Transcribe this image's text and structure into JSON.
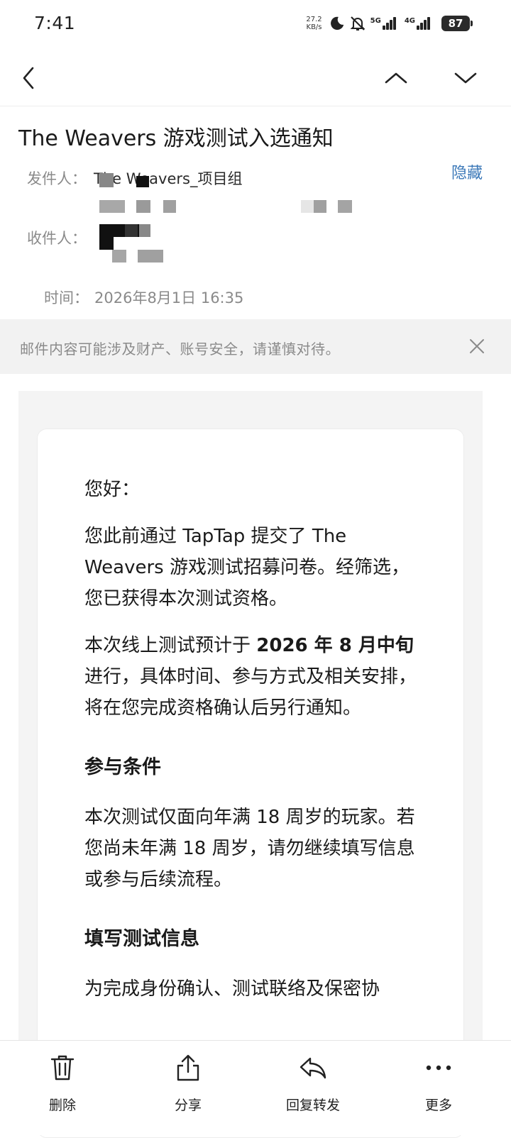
{
  "status_bar": {
    "time": "7:41",
    "net_speed_value": "27.2",
    "net_speed_unit": "KB/s",
    "signal_1_label": "5G",
    "signal_2_label": "4G",
    "battery_level": "87"
  },
  "nav": {
    "back_icon": "chevron-left-icon",
    "prev_icon": "chevron-up-icon",
    "next_icon": "chevron-down-icon"
  },
  "header": {
    "subject": "The Weavers 游戏测试入选通知",
    "sender_label": "发件人：",
    "sender_name": "The Weavers_项目组",
    "recipient_label": "收件人：",
    "time_label": "时间：",
    "time_value": "2026年8月1日 16:35",
    "hide_link": "隐藏"
  },
  "warning": {
    "text": "邮件内容可能涉及财产、账号安全，请谨慎对待。",
    "close_icon": "close-icon"
  },
  "email_body": {
    "greeting": "您好：",
    "para1": "您此前通过 TapTap 提交了 The Weavers 游戏测试招募问卷。经筛选，您已获得本次测试资格。",
    "para2_prefix": "本次线上测试预计于 ",
    "para2_bold": "2026 年 8 月中旬",
    "para2_suffix": " 进行，具体时间、参与方式及相关安排，将在您完成资格确认后另行通知。",
    "section1_title": "参与条件",
    "section1_text": "本次测试仅面向年满 18 周岁的玩家。若您尚未年满 18 周岁，请勿继续填写信息或参与后续流程。",
    "section2_title": "填写测试信息",
    "section2_text_partial": "为完成身份确认、测试联络及保密协"
  },
  "toolbar": {
    "delete_label": "删除",
    "share_label": "分享",
    "reply_label": "回复转发",
    "more_label": "更多"
  },
  "colors": {
    "accent_link": "#3b78b8",
    "warning_bg": "#f2f2f2",
    "mail_bg": "#f4f4f4"
  }
}
